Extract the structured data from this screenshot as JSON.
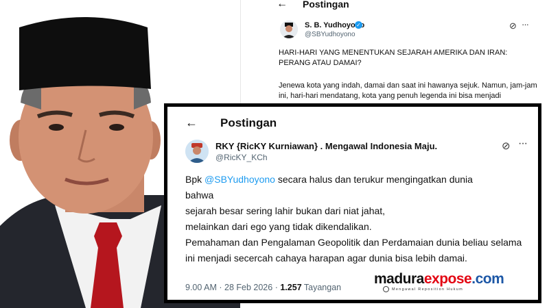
{
  "back_post": {
    "header_title": "Postingan",
    "author_name": "S. B. Yudhoyono",
    "author_handle": "@SBYudhoyono",
    "headline": "HARI-HARI YANG MENENTUKAN SEJARAH AMERIKA DAN IRAN: PERANG ATAU DAMAI?",
    "body": "Jenewa kota yang indah, damai dan saat ini hawanya sejuk. Namun, jam-jam ini, hari-hari mendatang, kota yang penuh legenda ini bisa menjadi"
  },
  "front_post": {
    "header_title": "Postingan",
    "author_name": "RKY {RicKY Kurniawan} . Mengawal Indonesia Maju.",
    "author_handle": "@RicKY_KCh",
    "body_prefix": "Bpk ",
    "mention": "@SBYudhoyono",
    "body_line1_rest": " secara halus dan terukur  mengingatkan dunia",
    "body_line2": "bahwa",
    "body_line3": "sejarah besar sering lahir bukan dari niat jahat,",
    "body_line4": "melainkan dari ego yang tidak dikendalikan.",
    "body_line5": "Pemahaman dan Pengalaman Geopolitik dan Perdamaian dunia beliau selama ini menjadi secercah cahaya  harapan agar dunia bisa lebih damai.",
    "time": "9.00 AM",
    "date": "28 Feb 2026",
    "separator": "·",
    "views_count": "1.257",
    "views_label": "Tayangan"
  },
  "watermark": {
    "brand_part1": "madura",
    "brand_part2": "expose",
    "brand_part3": ".com",
    "tagline": "Mengawal Reposition Hukum"
  },
  "colors": {
    "mention": "#1d9bf0",
    "brand_red": "#e30613",
    "brand_blue": "#1c57a6",
    "frame": "#000000"
  },
  "icons": [
    "back-arrow-icon",
    "verified-icon",
    "grok-icon",
    "more-icon"
  ]
}
